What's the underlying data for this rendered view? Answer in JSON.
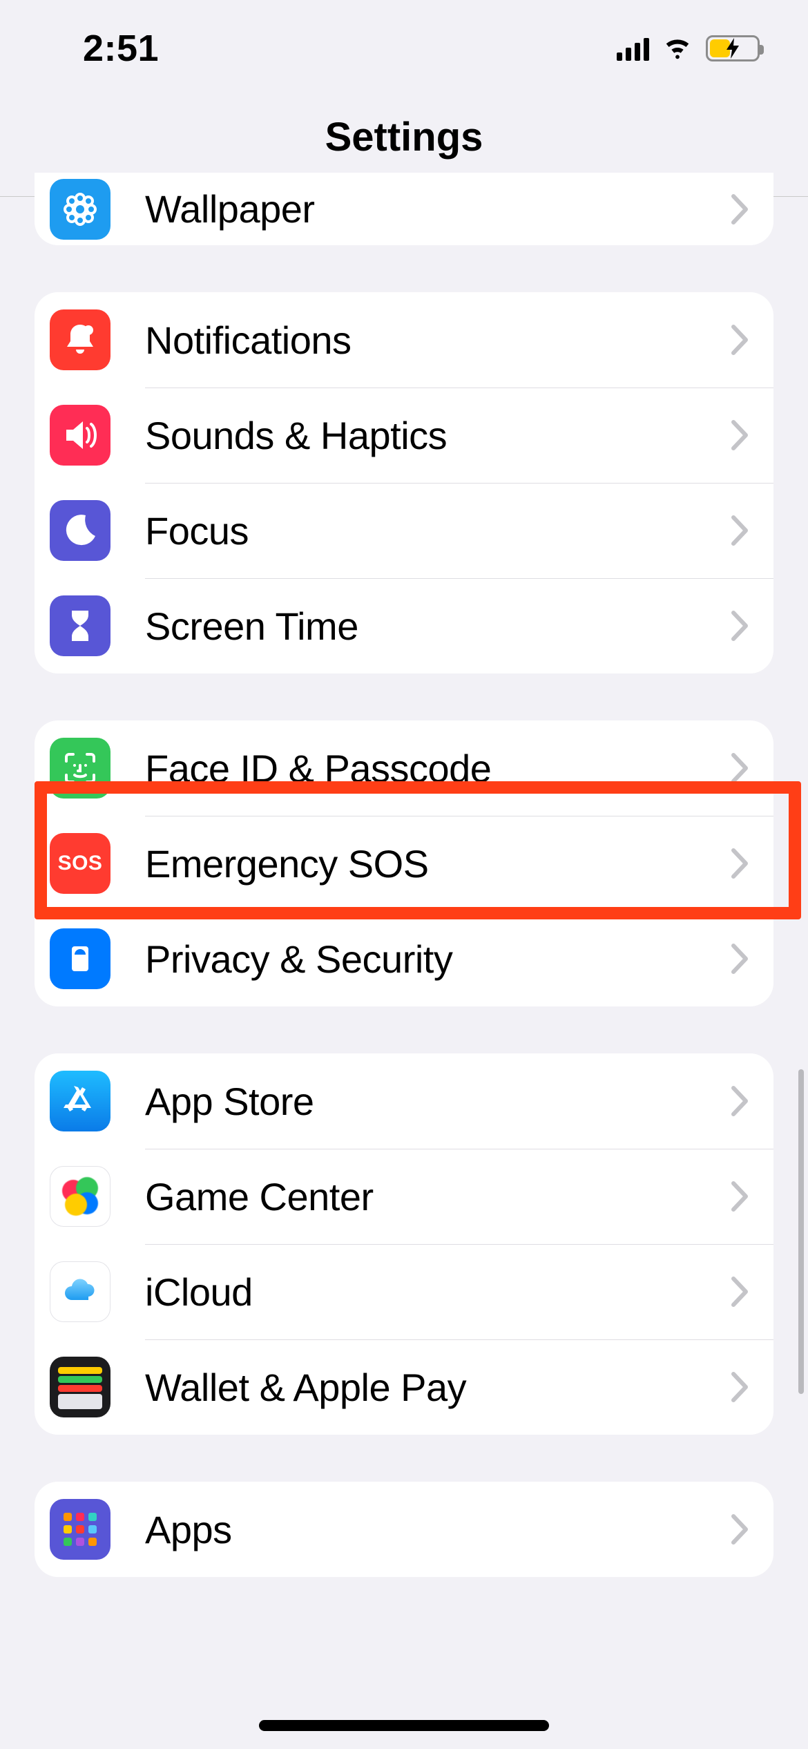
{
  "status": {
    "time": "2:51"
  },
  "header": {
    "title": "Settings"
  },
  "groups": [
    {
      "rows": [
        {
          "id": "wallpaper",
          "label": "Wallpaper"
        }
      ]
    },
    {
      "rows": [
        {
          "id": "notifications",
          "label": "Notifications"
        },
        {
          "id": "sounds",
          "label": "Sounds & Haptics"
        },
        {
          "id": "focus",
          "label": "Focus"
        },
        {
          "id": "screentime",
          "label": "Screen Time"
        }
      ]
    },
    {
      "rows": [
        {
          "id": "faceid",
          "label": "Face ID & Passcode"
        },
        {
          "id": "sos",
          "label": "Emergency SOS"
        },
        {
          "id": "privacy",
          "label": "Privacy & Security"
        }
      ]
    },
    {
      "rows": [
        {
          "id": "appstore",
          "label": "App Store"
        },
        {
          "id": "gamecenter",
          "label": "Game Center"
        },
        {
          "id": "icloud",
          "label": "iCloud"
        },
        {
          "id": "wallet",
          "label": "Wallet & Apple Pay"
        }
      ]
    },
    {
      "rows": [
        {
          "id": "apps",
          "label": "Apps"
        }
      ]
    }
  ],
  "highlight": {
    "row_id": "faceid"
  },
  "sos_label": "SOS"
}
